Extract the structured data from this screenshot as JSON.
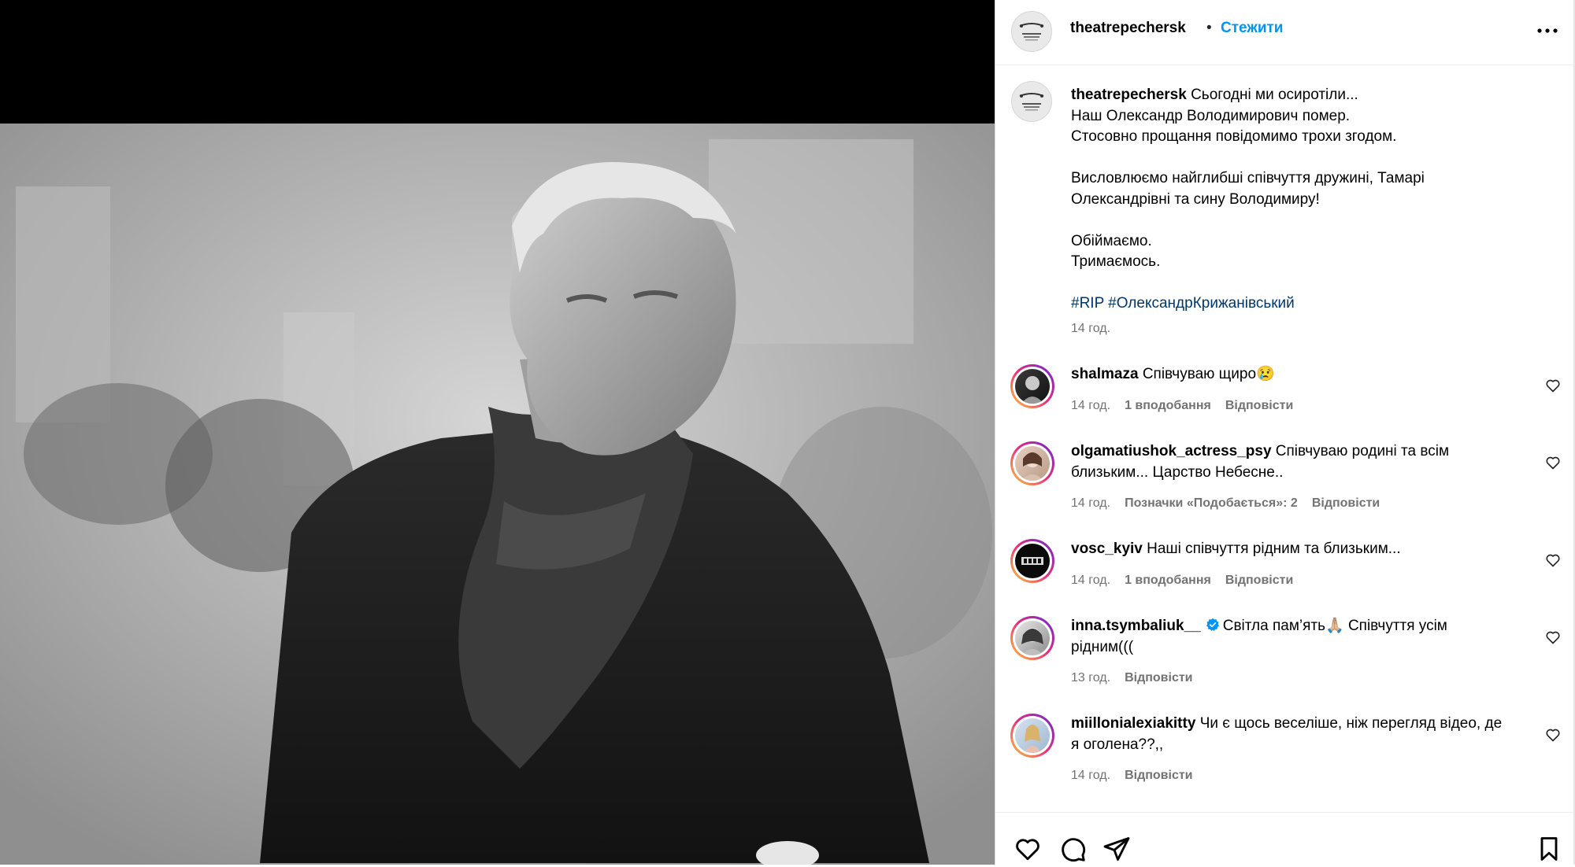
{
  "post": {
    "username": "theatrepechersk",
    "separator": "•",
    "follow_label": "Стежити",
    "more_icon": "more-horizontal-icon",
    "caption_lines": [
      "Сьогодні ми осиротіли...",
      "Наш Олександр Володимирович помер.",
      "Стосовно прощання повідомимо трохи згодом.",
      "",
      "Висловлюємо найглибші співчуття дружині, Тамарі",
      "Олександрівні та сину Володимиру!",
      "",
      "Обіймаємо.",
      "Тримаємось.",
      ""
    ],
    "hashtags": "#RIP #ОлександрКрижанівський",
    "time": "14 год."
  },
  "comments": [
    {
      "username": "shalmaza",
      "text": "Співчуваю щиро😢",
      "time": "14 год.",
      "likes": "1 вподобання",
      "reply": "Відповісти",
      "verified": false
    },
    {
      "username": "olgamatiushok_actress_psy",
      "text": "Співчуваю родині та всім близьким... Царство Небесне..",
      "time": "14 год.",
      "likes": "Позначки «Подобається»: 2",
      "reply": "Відповісти",
      "verified": false
    },
    {
      "username": "vosc_kyiv",
      "text": "Наші співчуття рідним та близьким...",
      "time": "14 год.",
      "likes": "1 вподобання",
      "reply": "Відповісти",
      "verified": false
    },
    {
      "username": "inna.tsymbaliuk__",
      "text": "Світла пам’ять🙏🏼 Співчуття усім рідним(((",
      "time": "13 год.",
      "likes": "",
      "reply": "Відповісти",
      "verified": true
    },
    {
      "username": "miillonialexiakitty",
      "text": "Чи є щось веселіше, ніж перегляд відео, де я оголена??,,",
      "time": "14 год.",
      "likes": "",
      "reply": "Відповісти",
      "verified": false
    }
  ],
  "actions": {
    "like_icon": "heart-icon",
    "comment_icon": "comment-icon",
    "share_icon": "share-icon",
    "save_icon": "bookmark-icon"
  },
  "colors": {
    "accent": "#0095f6",
    "hashtag": "#00376b",
    "muted": "#737373"
  }
}
